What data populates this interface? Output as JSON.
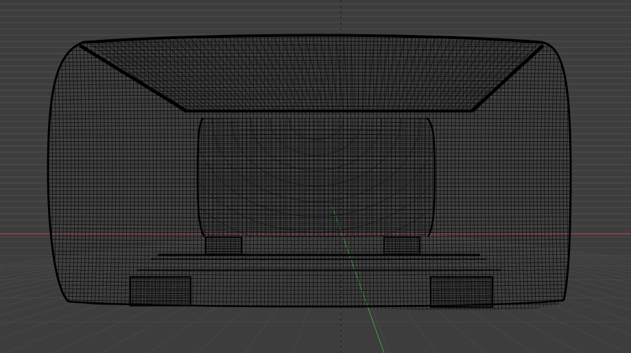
{
  "viewport": {
    "view": "front",
    "shading": "wireframe",
    "colors": {
      "background": "#3d3d3d",
      "grid": "#545454",
      "grid_dark": "#4a4a4a",
      "x_axis": "#b04848",
      "y_axis": "#3a9a3a",
      "center_guide": "#1e1e1e",
      "wire": "#0a0a0a",
      "edge": "#000000"
    }
  }
}
